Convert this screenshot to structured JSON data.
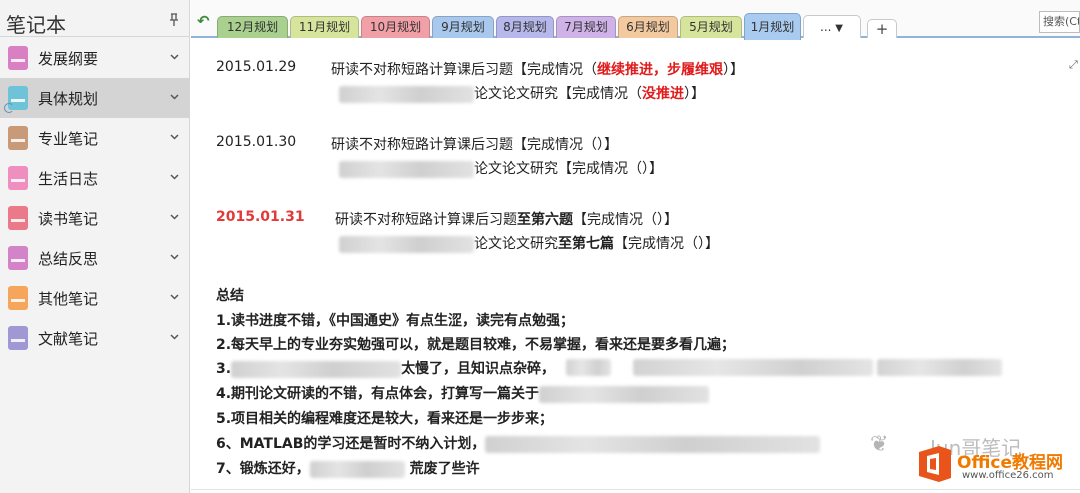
{
  "sidebar": {
    "title": "笔记本",
    "items": [
      {
        "label": "发展纲要",
        "color": "#d97fc4"
      },
      {
        "label": "具体规划",
        "color": "#6fc3d9",
        "selected": true
      },
      {
        "label": "专业笔记",
        "color": "#c89a78"
      },
      {
        "label": "生活日志",
        "color": "#ee8fc0"
      },
      {
        "label": "读书笔记",
        "color": "#ea7a8a"
      },
      {
        "label": "总结反思",
        "color": "#d383c8"
      },
      {
        "label": "其他笔记",
        "color": "#f5a65c"
      },
      {
        "label": "文献笔记",
        "color": "#9f98d4"
      }
    ]
  },
  "tabs": [
    {
      "label": "12月规划",
      "color": "#a9d08e"
    },
    {
      "label": "11月规划",
      "color": "#d6e49c"
    },
    {
      "label": "10月规划",
      "color": "#f2a0a8"
    },
    {
      "label": "9月规划",
      "color": "#a8c8ee"
    },
    {
      "label": "8月规划",
      "color": "#b6b8ec"
    },
    {
      "label": "7月规划",
      "color": "#cfb2e8"
    },
    {
      "label": "6月规划",
      "color": "#f3c9a0"
    },
    {
      "label": "5月规划",
      "color": "#d6e49c"
    },
    {
      "label": "1月规划",
      "color": "#a9cbef",
      "active": true
    }
  ],
  "tab_more_label": "...",
  "tab_add_label": "+",
  "search_placeholder": "搜索(Ctrl+E)",
  "entries": [
    {
      "date": "2015.01.29",
      "line1_a": "研读不对称短路计算课后习题【完成情况（",
      "line1_red": "继续推进，步履维艰",
      "line1_c": "）】",
      "line2_a": "论文论文研究【完成情况（",
      "line2_red": "没推进",
      "line2_c": "）】"
    },
    {
      "date": "2015.01.30",
      "line1": "研读不对称短路计算课后习题【完成情况（）】",
      "line2": "论文论文研究【完成情况（）】"
    },
    {
      "date": "2015.01.31",
      "line1_a": "研读不对称短路计算课后习题",
      "line1_b": "至第六题",
      "line1_c": "【完成情况（）】",
      "line2_a": "论文论文研究",
      "line2_b": "至第七篇",
      "line2_c": "【完成情况（）】"
    }
  ],
  "summary": {
    "heading": "总结",
    "items": [
      "1.读书进度不错，《中国通史》有点生涩，读完有点勉强；",
      "2.每天早上的专业夯实勉强可以，就是题目较难，不易掌握，看来还是要多看几遍；",
      "3.",
      "太慢了，且知识点杂碎，",
      "4.期刊论文研读的不错，有点体会，打算写一篇关于",
      "5.项目相关的编程难度还是较大，看来还是一步步来；",
      "6、MATLAB的学习还是暂时不纳入计划，",
      "7、锻炼还好，",
      "荒废了些许"
    ]
  },
  "watermark": {
    "name": "Jun哥笔记",
    "brand": "Office教程网",
    "url": "www.office26.com"
  }
}
